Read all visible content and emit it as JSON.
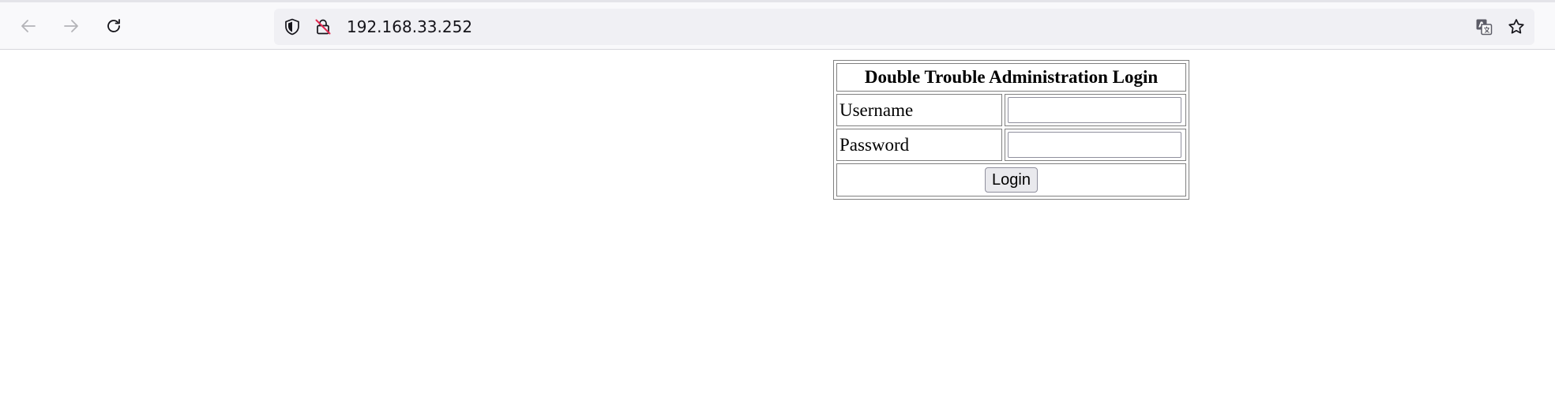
{
  "browser": {
    "url": "192.168.33.252",
    "icons": {
      "back": "back-arrow-icon",
      "forward": "forward-arrow-icon",
      "reload": "reload-icon",
      "shield": "tracking-protection-shield-icon",
      "insecure": "insecure-lock-icon",
      "translate": "translate-icon",
      "bookmark": "bookmark-star-icon"
    },
    "colors": {
      "insecure_accent": "#e22850",
      "toolbar_bg": "#f9f9fb",
      "urlbar_bg": "#f0f0f4"
    }
  },
  "login": {
    "title": "Double Trouble Administration Login",
    "username_label": "Username",
    "username_value": "",
    "password_label": "Password",
    "password_value": "",
    "submit_label": "Login"
  }
}
